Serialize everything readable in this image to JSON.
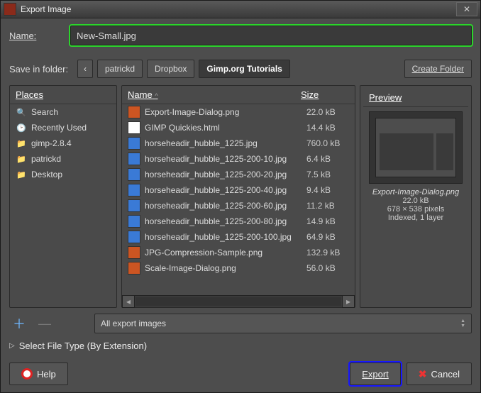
{
  "window": {
    "title": "Export Image"
  },
  "name": {
    "label": "Name:",
    "value": "New-Small.jpg"
  },
  "save_in": {
    "label": "Save in folder:",
    "back_icon": "‹",
    "crumbs": [
      "patrickd",
      "Dropbox",
      "Gimp.org Tutorials"
    ],
    "create_folder": "Create Folder"
  },
  "places": {
    "header": "Places",
    "items": [
      {
        "icon": "search",
        "label": "Search"
      },
      {
        "icon": "recent",
        "label": "Recently Used"
      },
      {
        "icon": "folder",
        "label": "gimp-2.8.4"
      },
      {
        "icon": "folder",
        "label": "patrickd"
      },
      {
        "icon": "folder",
        "label": "Desktop"
      }
    ]
  },
  "files": {
    "name_header": "Name",
    "size_header": "Size",
    "rows": [
      {
        "icon": "png",
        "name": "Export-Image-Dialog.png",
        "size": "22.0 kB"
      },
      {
        "icon": "html",
        "name": "GIMP Quickies.html",
        "size": "14.4 kB"
      },
      {
        "icon": "jpg",
        "name": "horseheadir_hubble_1225.jpg",
        "size": "760.0 kB"
      },
      {
        "icon": "jpg",
        "name": "horseheadir_hubble_1225-200-10.jpg",
        "size": "6.4 kB"
      },
      {
        "icon": "jpg",
        "name": "horseheadir_hubble_1225-200-20.jpg",
        "size": "7.5 kB"
      },
      {
        "icon": "jpg",
        "name": "horseheadir_hubble_1225-200-40.jpg",
        "size": "9.4 kB"
      },
      {
        "icon": "jpg",
        "name": "horseheadir_hubble_1225-200-60.jpg",
        "size": "11.2 kB"
      },
      {
        "icon": "jpg",
        "name": "horseheadir_hubble_1225-200-80.jpg",
        "size": "14.9 kB"
      },
      {
        "icon": "jpg",
        "name": "horseheadir_hubble_1225-200-100.jpg",
        "size": "64.9 kB"
      },
      {
        "icon": "png",
        "name": "JPG-Compression-Sample.png",
        "size": "132.9 kB"
      },
      {
        "icon": "png",
        "name": "Scale-Image-Dialog.png",
        "size": "56.0 kB"
      }
    ]
  },
  "preview": {
    "header": "Preview",
    "filename": "Export-Image-Dialog.png",
    "size": "22.0 kB",
    "dims": "678 × 538 pixels",
    "mode": "Indexed, 1 layer"
  },
  "filter": {
    "label": "All export images"
  },
  "filetype": {
    "label": "Select File Type (By Extension)"
  },
  "buttons": {
    "help": "Help",
    "export": "Export",
    "cancel": "Cancel"
  }
}
